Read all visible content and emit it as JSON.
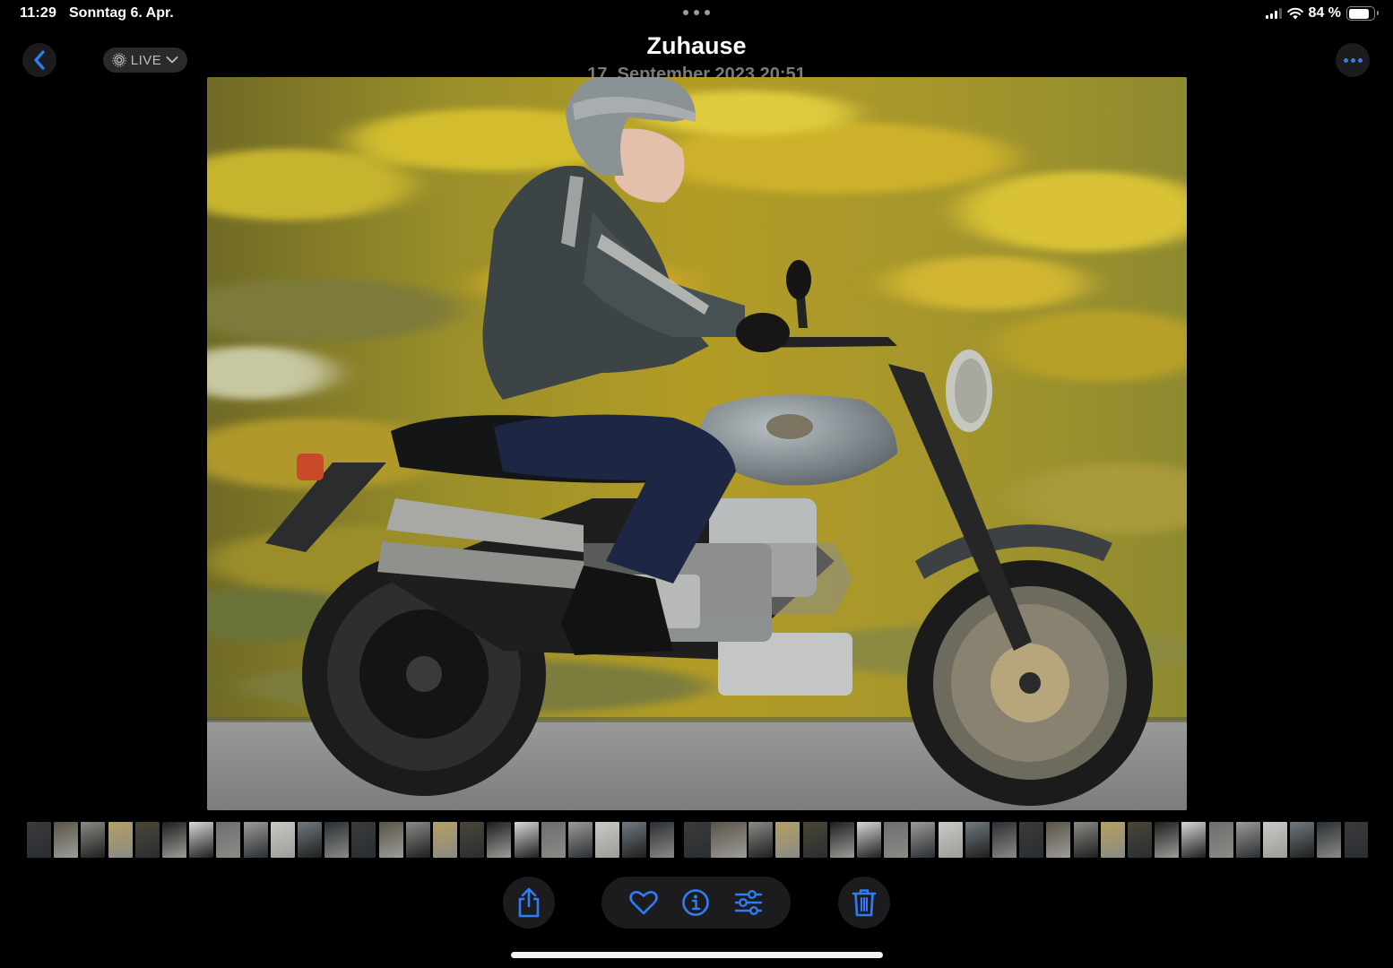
{
  "status_bar": {
    "time": "11:29",
    "date": "Sonntag 6. Apr.",
    "battery_label": "84 %",
    "battery_level": 0.84,
    "signal_bars": 4,
    "signal_active": 3
  },
  "nav": {
    "live_label": "LIVE",
    "title": "Zuhause",
    "subtitle": "17. September 2023  20:51"
  },
  "photo": {
    "thumbnail_count": 50
  },
  "toolbar": {
    "icons": [
      "share-icon",
      "heart-icon",
      "info-icon",
      "adjust-icon",
      "trash-icon"
    ]
  },
  "colors": {
    "accent": "#2f7df6",
    "button_bg": "#1c1c1e"
  }
}
